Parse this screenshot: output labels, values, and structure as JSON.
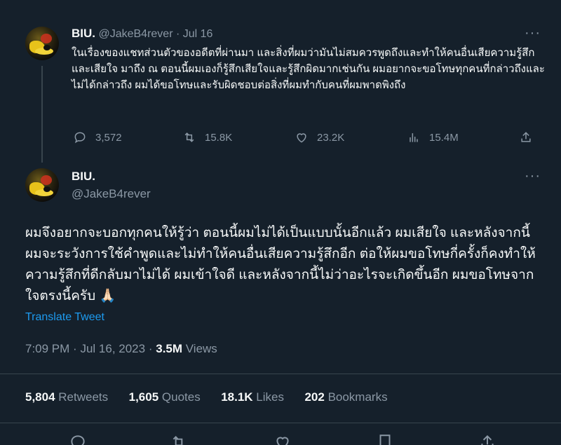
{
  "tweet1": {
    "name": "BIU.",
    "handle": "@JakeB4rever",
    "separator": "·",
    "date": "Jul 16",
    "more": "···",
    "text": "ในเรื่องของแชทส่วนตัวของอดีตที่ผ่านมา และสิ่งที่ผมว่ามันไม่สมควรพูดถึงและทำให้คนอื่นเสียความรู้สึกและเสียใจ มาถึง ณ ตอนนี้ผมเองก็รู้สึกเสียใจและรู้สึกผิดมากเช่นกัน ผมอยากจะขอโทษทุกคนที่กล่าวถึงและไม่ได้กล่าวถึง ผมได้ขอโทษและรับผิดชอบต่อสิ่งที่ผมทำกับคนที่ผมพาดพิงถึง",
    "actions": {
      "replies": "3,572",
      "retweets": "15.8K",
      "likes": "23.2K",
      "views": "15.4M"
    }
  },
  "tweet2": {
    "name": "BIU.",
    "handle": "@JakeB4rever",
    "more": "···",
    "text": "ผมจึงอยากจะบอกทุกคนให้รู้ว่า ตอนนี้ผมไม่ได้เป็นแบบนั้นอีกแล้ว ผมเสียใจ และหลังจากนี้ผมจะระวังการใช้คำพูดและไม่ทำให้คนอื่นเสียความรู้สึกอีก ต่อให้ผมขอโทษกี่ครั้งก็คงทำให้ความรู้สึกที่ดีกลับมาไม่ได้ ผมเข้าใจดี และหลังจากนี้ไม่ว่าอะไรจะเกิดขึ้นอีก ผมขอโทษจากใจตรงนี้ครับ",
    "emoji": "🙏🏻",
    "translate_label": "Translate Tweet",
    "time": "7:09 PM",
    "date": "Jul 16, 2023",
    "views_count": "3.5M",
    "views_label": "Views",
    "stats": {
      "retweets_count": "5,804",
      "retweets_label": "Retweets",
      "quotes_count": "1,605",
      "quotes_label": "Quotes",
      "likes_count": "18.1K",
      "likes_label": "Likes",
      "bookmarks_count": "202",
      "bookmarks_label": "Bookmarks"
    }
  },
  "colors": {
    "background": "#15202b",
    "text": "#f7f9f9",
    "muted": "#8b98a5",
    "link": "#1d9bf0",
    "border": "#38444d"
  }
}
